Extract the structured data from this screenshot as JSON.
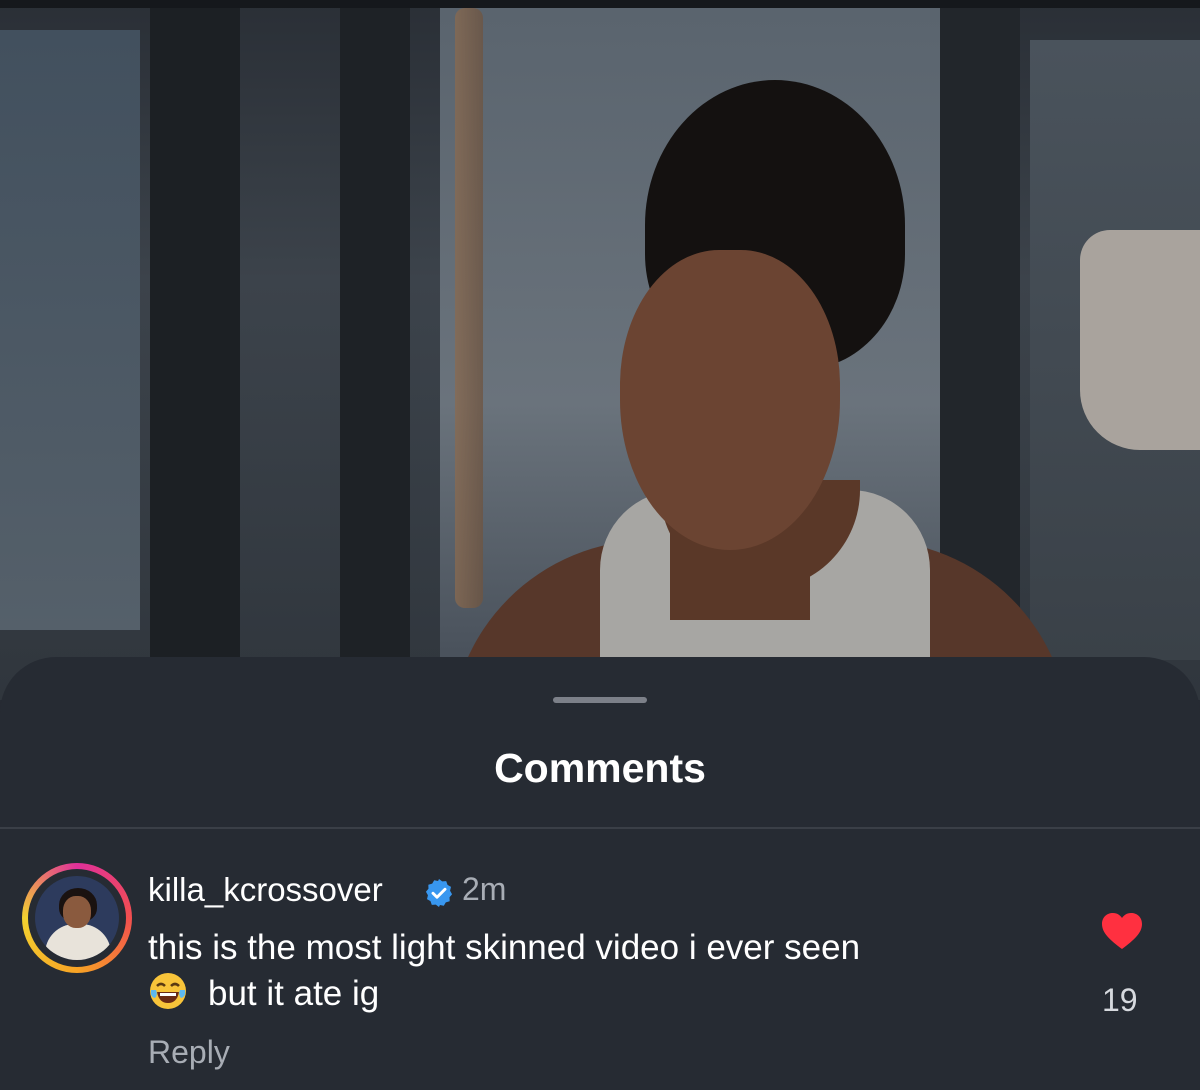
{
  "sheet": {
    "title": "Comments"
  },
  "comment": {
    "username": "killa_kcrossover",
    "verified": true,
    "timestamp": "2m",
    "text_line1": "this is the most light skinned video i ever seen",
    "text_line2": "but it ate ig",
    "emoji": "face-with-tears-of-joy",
    "reply_label": "Reply",
    "liked": true,
    "like_count": "19"
  },
  "colors": {
    "background": "#262b33",
    "heart": "#ff3040",
    "verified": "#3897f0",
    "secondary_text": "#a8adb5"
  },
  "icons": [
    "verified-badge-icon",
    "heart-icon",
    "laughing-emoji-icon"
  ]
}
